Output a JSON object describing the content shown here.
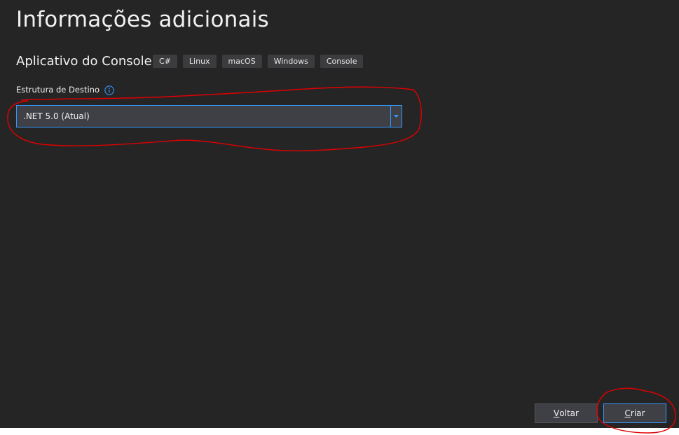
{
  "page": {
    "title": "Informações adicionais"
  },
  "template": {
    "name": "Aplicativo do Console",
    "tags": [
      "C#",
      "Linux",
      "macOS",
      "Windows",
      "Console"
    ]
  },
  "target_framework": {
    "label": "Estrutura de Destino",
    "selected": ".NET 5.0 (Atual)",
    "info_icon": "info-icon"
  },
  "buttons": {
    "back_mnemonic": "V",
    "back_rest": "oltar",
    "create_mnemonic": "C",
    "create_rest": "riar"
  },
  "colors": {
    "background": "#252526",
    "accent": "#3399ff",
    "annotation": "#e00000"
  }
}
